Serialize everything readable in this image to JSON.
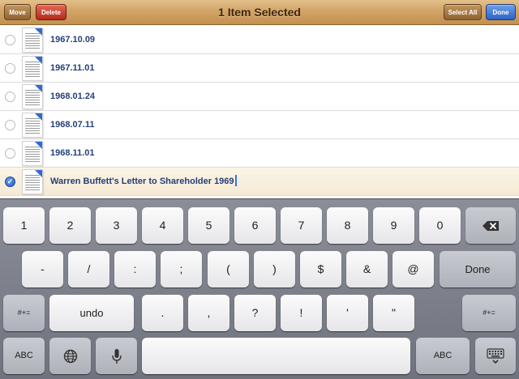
{
  "toolbar": {
    "move_label": "Move",
    "delete_label": "Delete",
    "title": "1 Item Selected",
    "select_all_label": "Select All",
    "done_label": "Done"
  },
  "list": {
    "items": [
      {
        "label": "1967.10.09",
        "selected": false
      },
      {
        "label": "1967.11.01",
        "selected": false
      },
      {
        "label": "1968.01.24",
        "selected": false
      },
      {
        "label": "1968.07.11",
        "selected": false
      },
      {
        "label": "1968.11.01",
        "selected": false
      },
      {
        "label": "Warren Buffett's Letter to Shareholder 1969",
        "selected": true
      }
    ]
  },
  "keyboard": {
    "row1": [
      "1",
      "2",
      "3",
      "4",
      "5",
      "6",
      "7",
      "8",
      "9",
      "0"
    ],
    "row1_icon": "backspace-icon",
    "row2": [
      "-",
      "/",
      ":",
      ";",
      "(",
      ")",
      "$",
      "&",
      "@"
    ],
    "row2_done": "Done",
    "row3": [
      "#+=",
      "undo",
      ".",
      ",",
      "?",
      "!",
      "'",
      "\"",
      "#+="
    ],
    "row4": {
      "left_abc": "ABC",
      "globe_icon": "globe-icon",
      "mic_icon": "microphone-icon",
      "right_abc": "ABC",
      "dismiss_icon": "keyboard-dismiss-icon"
    }
  },
  "colors": {
    "toolbar_wood": "#d2a467",
    "delete_red": "#c23a25",
    "done_blue": "#2f6bd0",
    "list_text": "#253f78",
    "keyboard_bg": "#7d808a"
  }
}
